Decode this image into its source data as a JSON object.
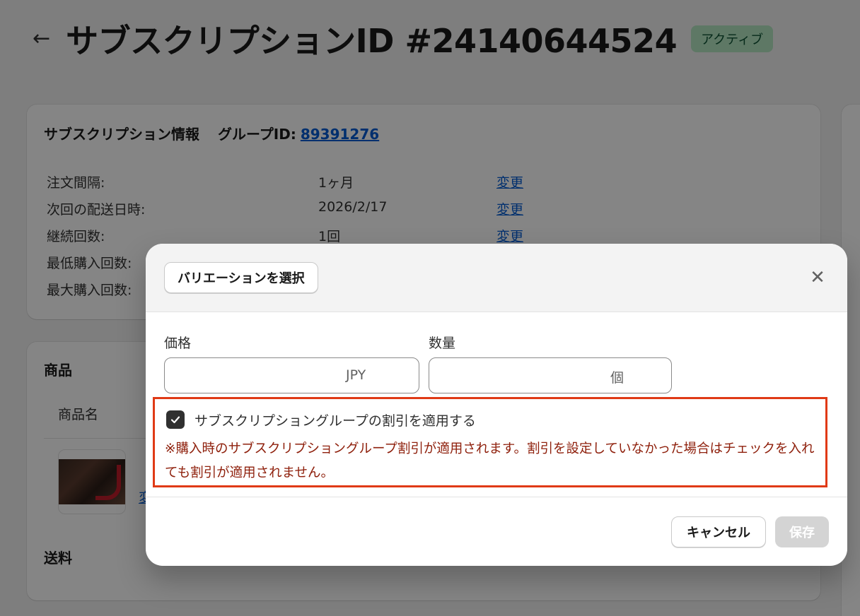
{
  "header": {
    "back_icon": "arrow-left-icon",
    "title": "サブスクリプションID #24140644524",
    "status": "アクティブ"
  },
  "subscription_info": {
    "title": "サブスクリプション情報",
    "group_label": "グループID:",
    "group_id": "89391276",
    "rows": [
      {
        "label": "注文間隔:",
        "value": "1ヶ月",
        "action": "変更"
      },
      {
        "label": "次回の配送日時:",
        "value": "2026/2/17",
        "action": "変更"
      },
      {
        "label": "継続回数:",
        "value": "1回",
        "action": "変更"
      },
      {
        "label": "最低購入回数:"
      },
      {
        "label": "最大購入回数:"
      }
    ]
  },
  "products": {
    "title": "商品",
    "column_name": "商品名",
    "link_partial": "変",
    "shipping_title": "送料"
  },
  "modal": {
    "variant_button": "バリエーションを選択",
    "close_icon": "close-icon",
    "price_label": "価格",
    "price_value": "",
    "price_suffix": "JPY",
    "quantity_label": "数量",
    "quantity_value": "",
    "quantity_suffix": "個",
    "discount_checkbox_checked": true,
    "discount_label": "サブスクリプショングループの割引を適用する",
    "note": "※購入時のサブスクリプショングループ割引が適用されます。割引を設定していなかった場合はチェックを入れても割引が適用されません。",
    "cancel_label": "キャンセル",
    "save_label": "保存"
  },
  "colors": {
    "highlight_border": "#e03a16",
    "note_text": "#8e1f0b",
    "badge_bg": "#b4e6c2",
    "link": "#005bd3"
  }
}
